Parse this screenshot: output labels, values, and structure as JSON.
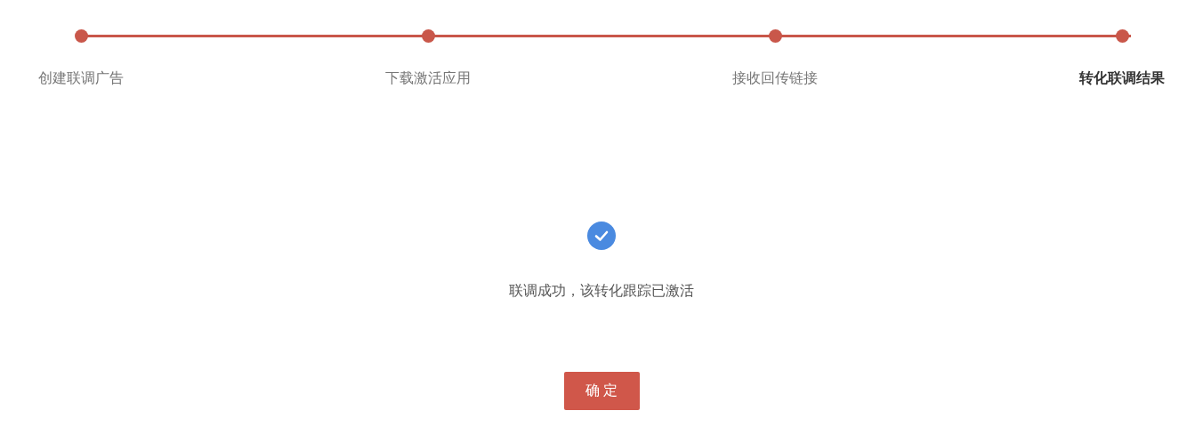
{
  "steps": [
    {
      "label": "创建联调广告",
      "current": false
    },
    {
      "label": "下载激活应用",
      "current": false
    },
    {
      "label": "接收回传链接",
      "current": false
    },
    {
      "label": "转化联调结果",
      "current": true
    }
  ],
  "result": {
    "message": "联调成功，该转化跟踪已激活"
  },
  "buttons": [
    "确 定"
  ]
}
